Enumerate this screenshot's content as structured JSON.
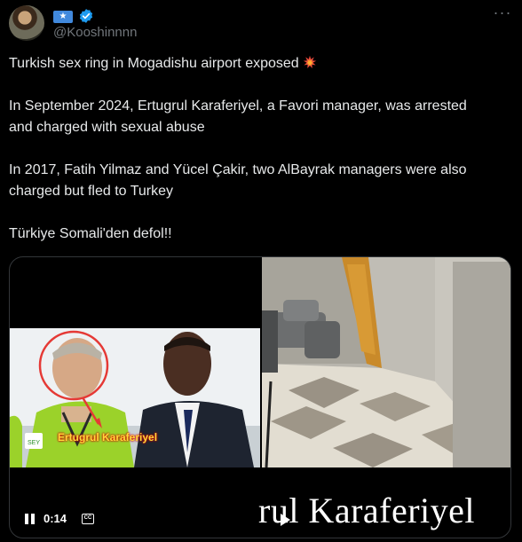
{
  "header": {
    "handle": "@Kooshinnnn",
    "more_label": "···"
  },
  "post": {
    "lines": [
      "Turkish sex ring in Mogadishu airport  exposed",
      "In September 2024, Ertugrul Karaferiyel, a Favori manager, was arrested",
      "and charged with sexual abuse",
      "In 2017, Fatih Yilmaz and Yücel Çakir, two AlBayrak managers were also",
      "charged but fled to Turkey",
      "Türkiye Somali'den defol!!"
    ]
  },
  "media": {
    "label_overlay": "Ertugrul Karaferiyel",
    "caption": "rul Karaferiyel",
    "vest_text": "SEY",
    "time": "0:14",
    "cc": "CC"
  },
  "colors": {
    "background": "#000000",
    "text": "#e7e9ea",
    "muted": "#71767b",
    "verified": "#1d9bf0",
    "flag": "#4189dd",
    "circle": "#e53935",
    "overlay_text": "#ffd83a"
  }
}
